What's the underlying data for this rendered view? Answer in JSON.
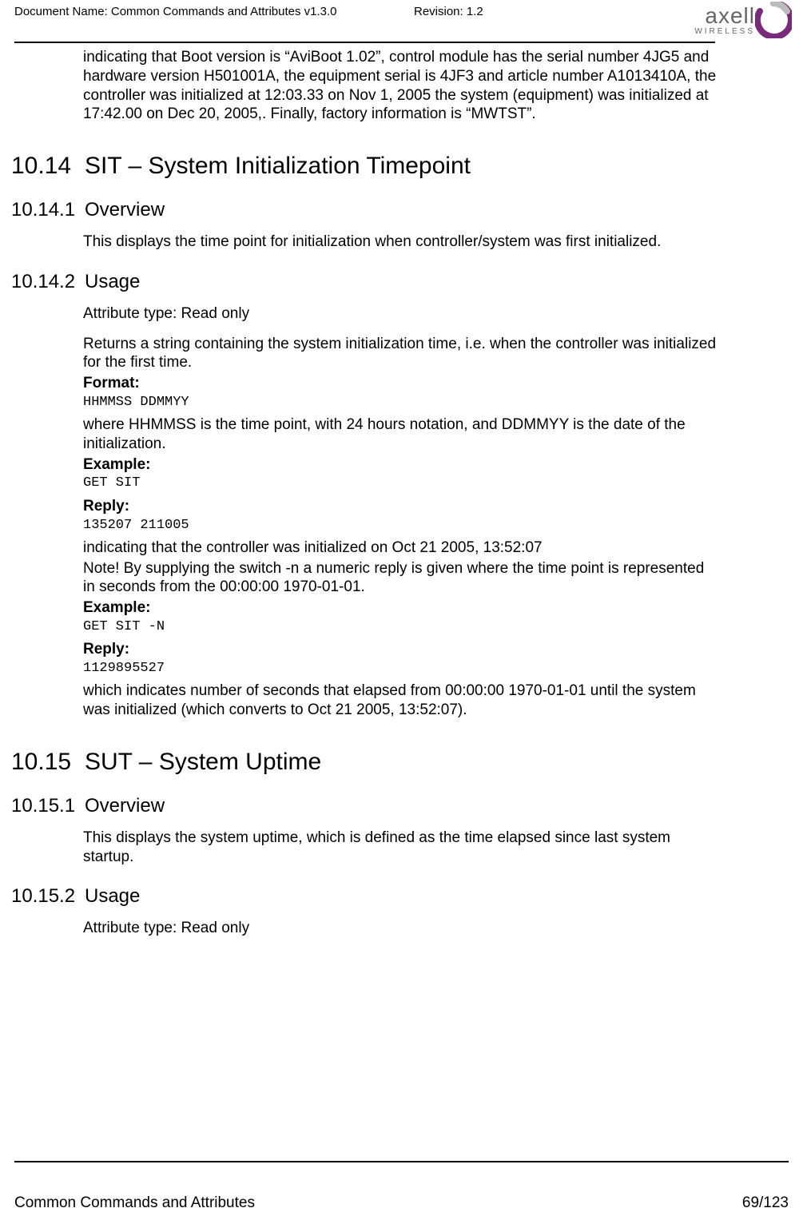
{
  "header": {
    "doc_name": "Document Name: Common Commands and Attributes v1.3.0",
    "revision": "Revision: 1.2",
    "logo_text": "axell",
    "logo_sub": "WIRELESS"
  },
  "intro_paragraph": "indicating that Boot version is “AviBoot 1.02”, control module has the serial number 4JG5 and hardware version H501001A, the equipment serial is 4JF3 and article number A1013410A, the controller was initialized at 12:03.33 on Nov 1, 2005 the system (equipment) was initialized at 17:42.00 on Dec 20, 2005,. Finally, factory information is “MWTST”.",
  "sec_10_14": {
    "num": "10.14",
    "title": "SIT – System Initialization Timepoint",
    "overview": {
      "num": "10.14.1",
      "title": "Overview",
      "p1": "This displays the time point for initialization when controller/system was first initialized."
    },
    "usage": {
      "num": "10.14.2",
      "title": "Usage",
      "attr": "Attribute type: Read only",
      "p1": "Returns a string containing the system initialization time, i.e. when the controller was initialized for the first time.",
      "format_label": "Format:",
      "format_code": "HHMMSS DDMMYY",
      "p2": "where HHMMSS is the time point, with 24 hours notation, and DDMMYY is the date of the initialization.",
      "example1_label": "Example:",
      "example1_code": "GET SIT",
      "reply1_label": "Reply:",
      "reply1_code": "135207 211005",
      "p3a": "indicating that the controller was initialized on Oct 21 2005, 13:52:07",
      "p3b": "Note! By supplying the switch -n a numeric reply is given where the time point is represented in seconds from the 00:00:00 1970-01-01.",
      "example2_label": "Example:",
      "example2_code": "GET SIT -N",
      "reply2_label": "Reply:",
      "reply2_code": "1129895527",
      "p4": "which indicates number of seconds that elapsed from  00:00:00 1970-01-01 until the system was initialized (which converts to Oct 21 2005, 13:52:07)."
    }
  },
  "sec_10_15": {
    "num": "10.15",
    "title": "SUT – System Uptime",
    "overview": {
      "num": "10.15.1",
      "title": "Overview",
      "p1": "This displays the system uptime, which is defined as the time elapsed since last system startup."
    },
    "usage": {
      "num": "10.15.2",
      "title": "Usage",
      "attr": "Attribute type: Read only"
    }
  },
  "footer": {
    "title": "Common Commands and Attributes",
    "page": "69/123"
  }
}
